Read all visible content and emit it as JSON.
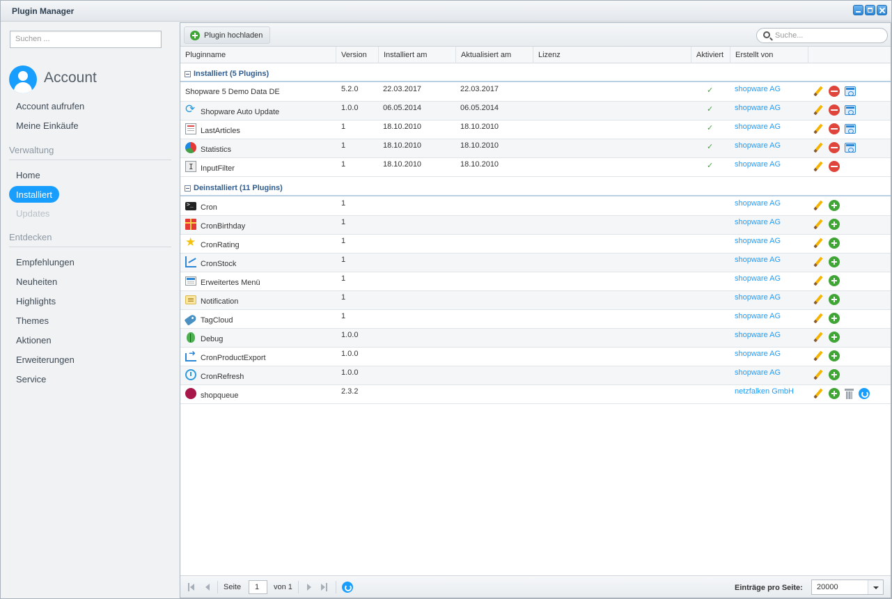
{
  "window": {
    "title": "Plugin Manager"
  },
  "sidebar": {
    "search_placeholder": "Suchen ...",
    "account_title": "Account",
    "account_items": [
      "Account aufrufen",
      "Meine Einkäufe"
    ],
    "section_verwaltung": "Verwaltung",
    "verwaltung_items": [
      "Home",
      "Installiert",
      "Updates"
    ],
    "active_item": "Installiert",
    "section_entdecken": "Entdecken",
    "entdecken_items": [
      "Empfehlungen",
      "Neuheiten",
      "Highlights",
      "Themes",
      "Aktionen",
      "Erweiterungen",
      "Service"
    ]
  },
  "toolbar": {
    "upload_label": "Plugin hochladen",
    "search_placeholder": "Suche..."
  },
  "columns": {
    "name": "Pluginname",
    "version": "Version",
    "installed": "Installiert am",
    "updated": "Aktualisiert am",
    "license": "Lizenz",
    "active": "Aktiviert",
    "author": "Erstellt von"
  },
  "groups": {
    "installed": "Installiert (5 Plugins)",
    "uninstalled": "Deinstalliert (11 Plugins)"
  },
  "active_mark": "✓",
  "installed_plugins": [
    {
      "name": "Shopware 5 Demo Data DE",
      "icon": "none",
      "version": "5.2.0",
      "installed": "22.03.2017",
      "updated": "22.03.2017",
      "author": "shopware AG",
      "config": true
    },
    {
      "name": "Shopware Auto Update",
      "icon": "auto-update-icon",
      "version": "1.0.0",
      "installed": "06.05.2014",
      "updated": "06.05.2014",
      "author": "shopware AG",
      "config": true
    },
    {
      "name": "LastArticles",
      "icon": "last-articles-icon",
      "version": "1",
      "installed": "18.10.2010",
      "updated": "18.10.2010",
      "author": "shopware AG",
      "config": true
    },
    {
      "name": "Statistics",
      "icon": "statistics-icon",
      "version": "1",
      "installed": "18.10.2010",
      "updated": "18.10.2010",
      "author": "shopware AG",
      "config": true
    },
    {
      "name": "InputFilter",
      "icon": "input-filter-icon",
      "version": "1",
      "installed": "18.10.2010",
      "updated": "18.10.2010",
      "author": "shopware AG",
      "config": false
    }
  ],
  "uninstalled_plugins": [
    {
      "name": "Cron",
      "icon": "terminal-icon",
      "version": "1",
      "author": "shopware AG"
    },
    {
      "name": "CronBirthday",
      "icon": "gift-icon",
      "version": "1",
      "author": "shopware AG"
    },
    {
      "name": "CronRating",
      "icon": "star-icon",
      "version": "1",
      "author": "shopware AG"
    },
    {
      "name": "CronStock",
      "icon": "stock-chart-icon",
      "version": "1",
      "author": "shopware AG"
    },
    {
      "name": "Erweitertes Menü",
      "icon": "menu-icon",
      "version": "1",
      "author": "shopware AG"
    },
    {
      "name": "Notification",
      "icon": "notification-icon",
      "version": "1",
      "author": "shopware AG"
    },
    {
      "name": "TagCloud",
      "icon": "tag-icon",
      "version": "1",
      "author": "shopware AG"
    },
    {
      "name": "Debug",
      "icon": "bug-icon",
      "version": "1.0.0",
      "author": "shopware AG"
    },
    {
      "name": "CronProductExport",
      "icon": "export-icon",
      "version": "1.0.0",
      "author": "shopware AG"
    },
    {
      "name": "CronRefresh",
      "icon": "refresh-clock-icon",
      "version": "1.0.0",
      "author": "shopware AG"
    },
    {
      "name": "shopqueue",
      "icon": "shopqueue-icon",
      "version": "2.3.2",
      "author": "netzfalken GmbH",
      "extra": true
    }
  ],
  "pager": {
    "page_label": "Seite",
    "page_value": "1",
    "of_label": "von 1",
    "per_page_label": "Einträge pro Seite:",
    "per_page_value": "20000"
  }
}
